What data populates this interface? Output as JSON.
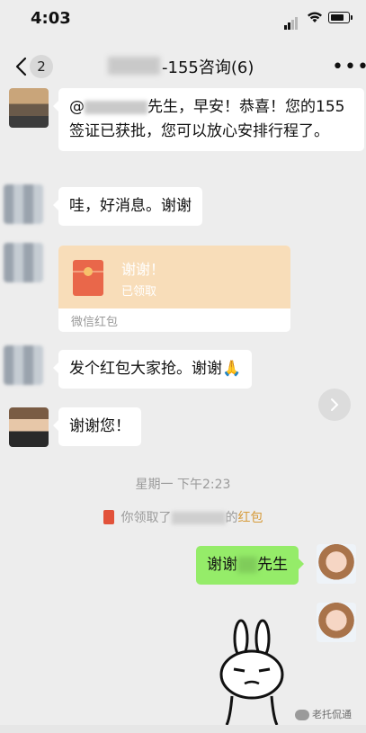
{
  "status_bar": {
    "time": "4:03"
  },
  "nav": {
    "back_count": "2",
    "title": "-155咨询(6)",
    "more": "•••"
  },
  "messages": {
    "m1": {
      "prefix": "@",
      "text": "先生，早安！恭喜！您的155签证已获批，您可以放心安排行程了。"
    },
    "m2": {
      "text": "哇，好消息。谢谢"
    },
    "red_packet": {
      "title": "谢谢！",
      "status": "已领取",
      "footer": "微信红包"
    },
    "m4": {
      "text": "发个红包大家抢。谢谢🙏"
    },
    "m5": {
      "text": "谢谢您！"
    },
    "timestamp": "星期一 下午2:23",
    "system": {
      "prefix": "你领取了",
      "suffix": "的",
      "link": "红包"
    },
    "m6": {
      "prefix": "谢谢",
      "suffix": "先生"
    }
  },
  "watermark": {
    "text": "老托侃通"
  },
  "icons": {
    "back": "chevron-left-icon",
    "more": "more-dots-icon",
    "scroll": "chevron-right-icon",
    "red_packet": "red-envelope-icon"
  },
  "colors": {
    "background": "#ededed",
    "bubble_self": "#95ec69",
    "red_packet": "#f8ddb9",
    "link": "#d69b3a"
  }
}
